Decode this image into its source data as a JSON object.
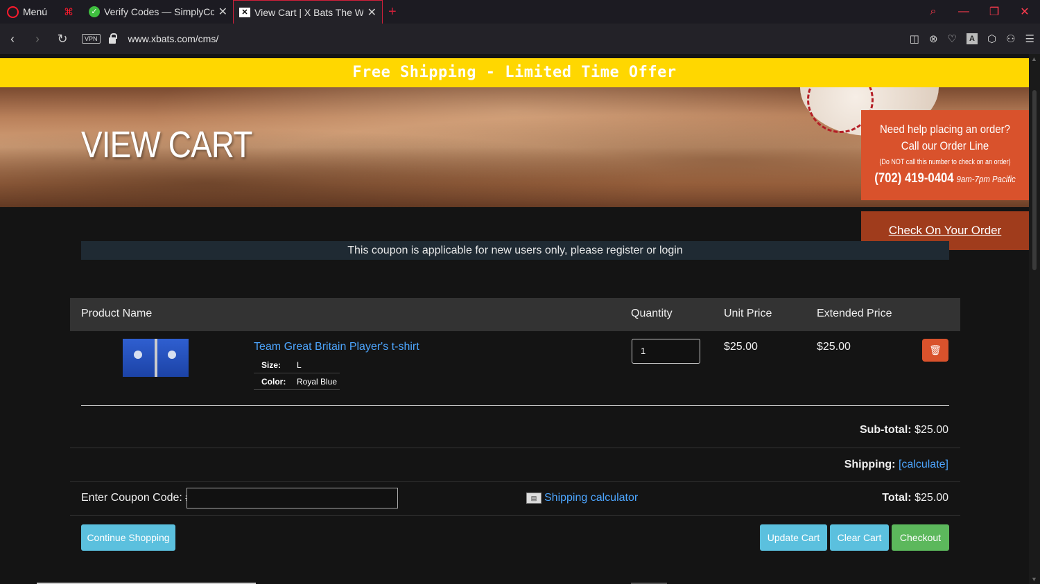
{
  "browser": {
    "menu_label": "Menú",
    "tabs": [
      {
        "title": "Verify Codes — SimplyCodes",
        "icon": "check-circle-icon"
      },
      {
        "title": "View Cart | X Bats The World",
        "icon": "xbats-favicon"
      }
    ],
    "url": "www.xbats.com/cms/",
    "vpn_label": "VPN",
    "accent_color": "#ff1b2d"
  },
  "page": {
    "promo_banner": "Free Shipping - Limited Time Offer",
    "hero_title": "VIEW CART",
    "help_box": {
      "line1": "Need help placing an order?",
      "line2": "Call our Order Line",
      "note": "(Do NOT call this number to check on an order)",
      "phone": "(702) 419-0404",
      "hours": "9am-7pm Pacific"
    },
    "check_order_label": "Check On Your Order",
    "coupon_notice": "This coupon is applicable for new users only, please register or login",
    "cart": {
      "headers": {
        "product": "Product Name",
        "quantity": "Quantity",
        "unit_price": "Unit Price",
        "extended_price": "Extended Price"
      },
      "item": {
        "name": "Team Great Britain Player's t-shirt",
        "size_key": "Size:",
        "size_value": "L",
        "color_key": "Color:",
        "color_value": "Royal Blue",
        "quantity": "1",
        "unit_price": "$25.00",
        "extended_price": "$25.00"
      },
      "subtotal_label": "Sub-total:",
      "subtotal_value": "$25.00",
      "shipping_label": "Shipping:",
      "shipping_link": "[calculate]",
      "coupon_label": "Enter Coupon Code: #",
      "coupon_value": "",
      "shipping_calc_label": "Shipping calculator",
      "total_label": "Total:",
      "total_value": "$25.00"
    },
    "buttons": {
      "continue": "Continue Shopping",
      "update": "Update Cart",
      "clear": "Clear Cart",
      "checkout": "Checkout"
    },
    "colors": {
      "promo": "#ffd700",
      "help": "#d9522c",
      "check_order": "#a03c1c",
      "link": "#4da6ff",
      "btn_info": "#5bc0de",
      "btn_success": "#5cb85c"
    }
  }
}
